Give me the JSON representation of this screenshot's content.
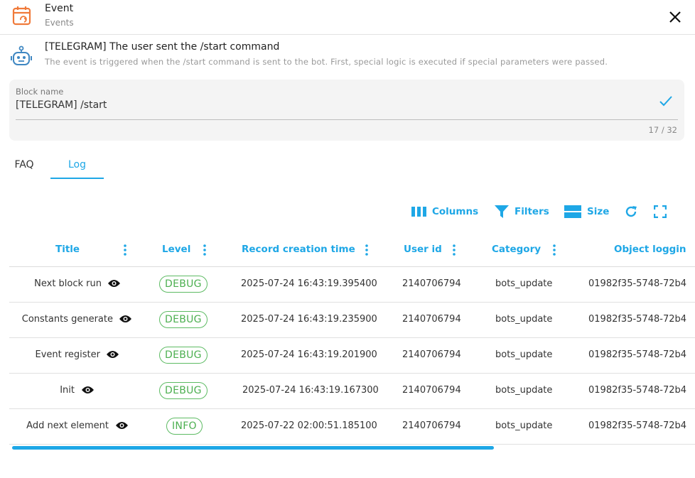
{
  "colors": {
    "accent": "#1ea7e6",
    "icon_orange": "#f07a3a",
    "bot_blue": "#3f87c2",
    "badge_green": "#4caf50"
  },
  "header": {
    "title": "Event",
    "subtitle": "Events",
    "icon": "calendar-sync-icon",
    "close_icon": "close-icon"
  },
  "event": {
    "title": "[TELEGRAM] The user sent the /start command",
    "description": "The event is triggered when the /start command is sent to the bot. First, special logic is executed if special parameters were passed.",
    "icon": "robot-icon"
  },
  "block_name": {
    "label": "Block name",
    "value": "[TELEGRAM] /start",
    "counter": "17 / 32"
  },
  "tabs": [
    {
      "label": "FAQ"
    },
    {
      "label": "Log"
    }
  ],
  "toolbar": {
    "columns": "Columns",
    "filters": "Filters",
    "size": "Size"
  },
  "table": {
    "columns": [
      "Title",
      "Level",
      "Record creation time",
      "User id",
      "Category",
      "Object loggin"
    ],
    "rows": [
      {
        "title": "Next block run",
        "level": "DEBUG",
        "time": "2025-07-24 16:43:19.395400",
        "user_id": "2140706794",
        "category": "bots_update",
        "object": "01982f35-5748-72b4"
      },
      {
        "title": "Constants generate",
        "level": "DEBUG",
        "time": "2025-07-24 16:43:19.235900",
        "user_id": "2140706794",
        "category": "bots_update",
        "object": "01982f35-5748-72b4"
      },
      {
        "title": "Event register",
        "level": "DEBUG",
        "time": "2025-07-24 16:43:19.201900",
        "user_id": "2140706794",
        "category": "bots_update",
        "object": "01982f35-5748-72b4"
      },
      {
        "title": "Init",
        "level": "DEBUG",
        "time": "2025-07-24 16:43:19.167300",
        "user_id": "2140706794",
        "category": "bots_update",
        "object": "01982f35-5748-72b4"
      },
      {
        "title": "Add next element",
        "level": "INFO",
        "time": "2025-07-22 02:00:51.185100",
        "user_id": "2140706794",
        "category": "bots_update",
        "object": "01982f35-5748-72b4"
      }
    ]
  }
}
